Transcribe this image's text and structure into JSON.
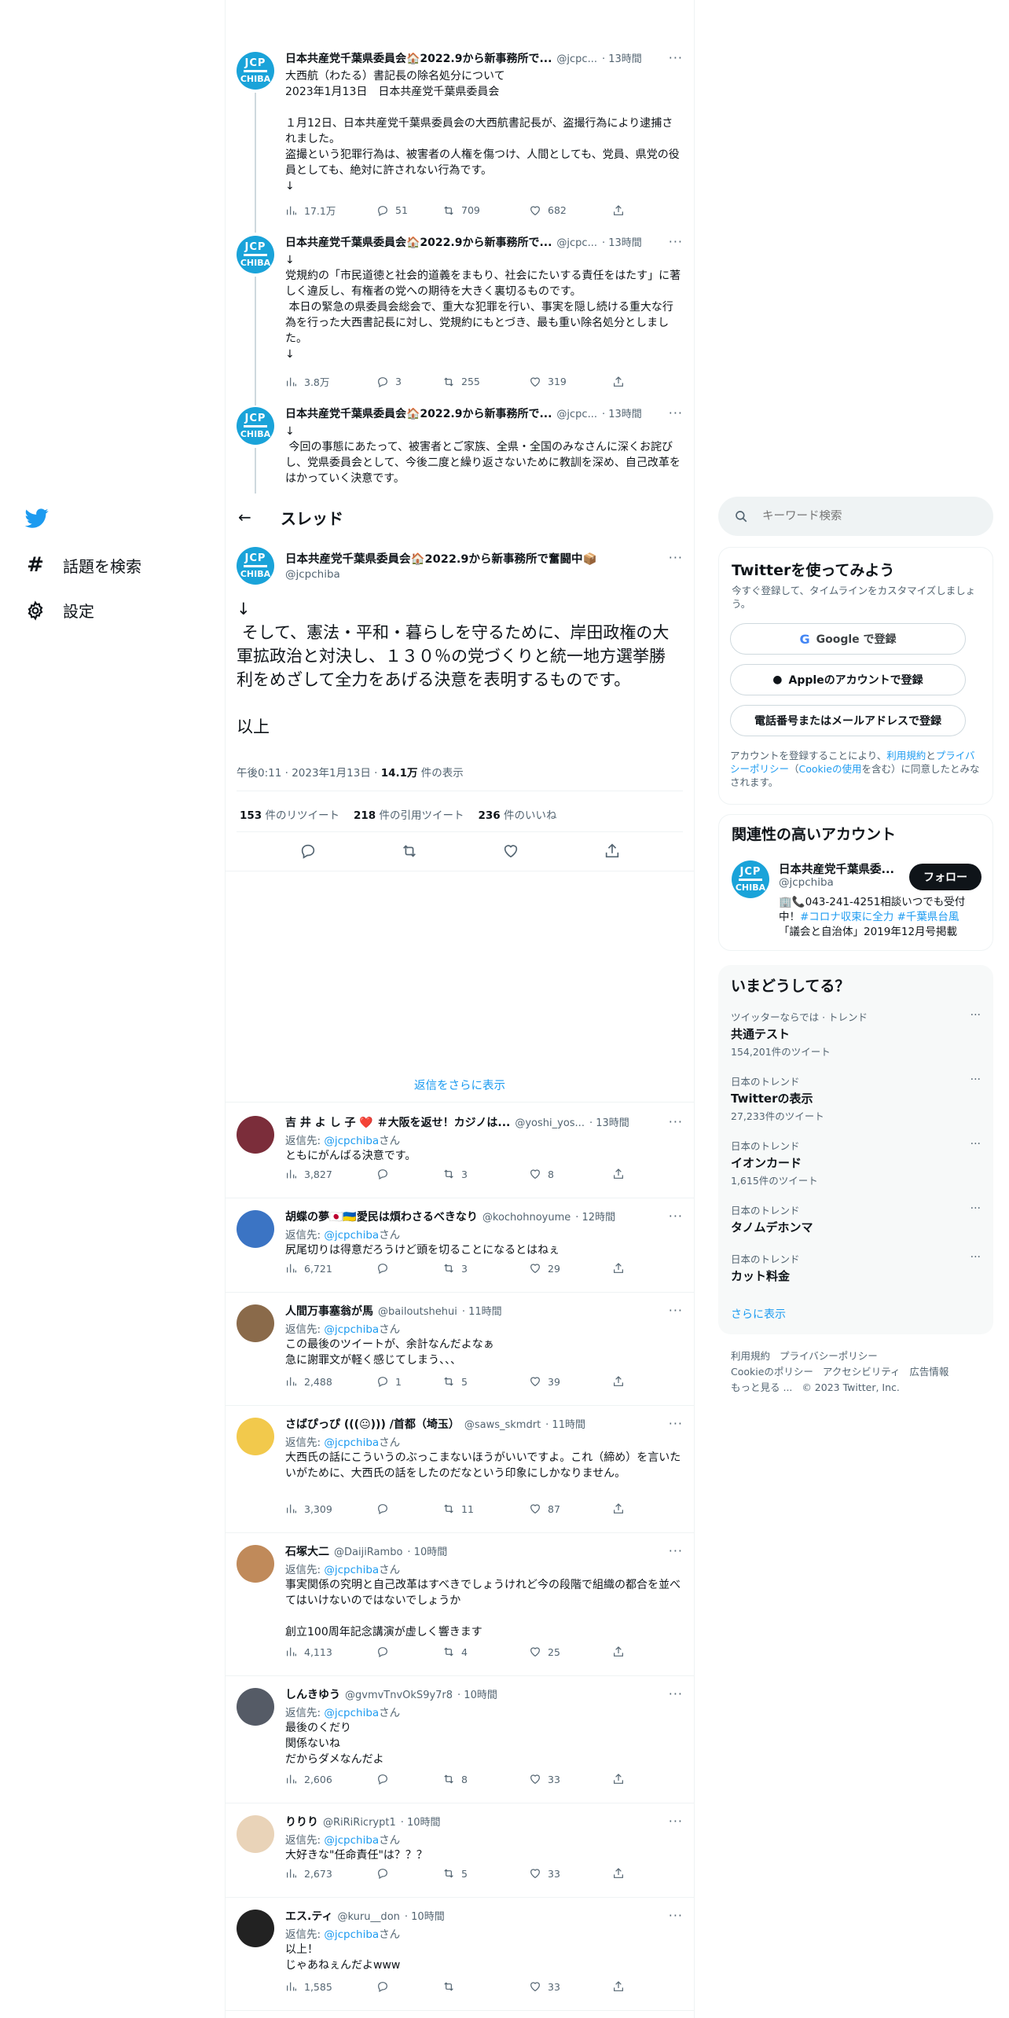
{
  "nav": {
    "explore_label": "話題を検索",
    "settings_label": "設定"
  },
  "thread_header": {
    "title": "スレッド"
  },
  "colors": {
    "accent": "#1d9bf0",
    "brand_avatar": "#1aa3d9"
  },
  "jcp_avatar": {
    "line1": "JCP",
    "line2": "CHIBA"
  },
  "context_tweets": [
    {
      "name": "日本共産党千葉県委員会🏠2022.9から新事務所で...",
      "handle": "@jcpc...",
      "time": "· 13時間",
      "text": "大西航（わたる）書記長の除名処分について\n2023年1月13日　日本共産党千葉県委員会\n\n１月12日、日本共産党千葉県委員会の大西航書記長が、盗撮行為により逮捕されました。\n盗撮という犯罪行為は、被害者の人権を傷つけ、人間としても、党員、県党の役員としても、絶対に許されない行為です。\n↓",
      "views": "17.1万",
      "replies": "51",
      "retweets": "709",
      "likes": "682"
    },
    {
      "name": "日本共産党千葉県委員会🏠2022.9から新事務所で...",
      "handle": "@jcpc...",
      "time": "· 13時間",
      "text": "↓\n党規約の「市民道徳と社会的道義をまもり、社会にたいする責任をはたす」に著しく違反し、有権者の党への期待を大きく裏切るものです。\n 本日の緊急の県委員会総会で、重大な犯罪を行い、事実を隠し続ける重大な行為を行った大西書記長に対し、党規約にもとづき、最も重い除名処分としました。\n↓",
      "views": "3.8万",
      "replies": "3",
      "retweets": "255",
      "likes": "319"
    },
    {
      "name": "日本共産党千葉県委員会🏠2022.9から新事務所で...",
      "handle": "@jcpc...",
      "time": "· 13時間",
      "text": "↓\n 今回の事態にあたって、被害者とご家族、全県・全国のみなさんに深くお詫びし、党県委員会として、今後二度と繰り返さないために教訓を深め、自己改革をはかっていく決意です。"
    }
  ],
  "main_tweet": {
    "name": "日本共産党千葉県委員会🏠2022.9から新事務所で奮闘中📦",
    "handle": "@jcpchiba",
    "text": "↓\n そして、憲法・平和・暮らしを守るために、岸田政権の大軍拡政治と対決し、１３０％の党づくりと統一地方選挙勝利をめざして全力をあげる決意を表明するものです。\n\n以上",
    "time": "午後0:11 · 2023年1月13日 · ",
    "views": "14.1万",
    "views_label": " 件の表示",
    "retweets": "153",
    "retweets_label": " 件のリツイート",
    "quotes": "218",
    "quotes_label": " 件の引用ツイート",
    "likes": "236",
    "likes_label": " 件のいいね"
  },
  "show_more_replies": "返信をさらに表示",
  "reply_prefix": "返信先: ",
  "reply_target": "@jcpchiba",
  "reply_suffix": "さん",
  "replies": [
    {
      "name": "吉 井 よ し 子 ❤️ ＃大阪を返せ！カジノは...",
      "handle": "@yoshi_yos...",
      "time": "· 13時間",
      "text": "ともにがんばる決意です。",
      "views": "3,827",
      "replies": "",
      "retweets": "3",
      "likes": "8"
    },
    {
      "name": "胡蝶の夢🇯🇵🇺🇦愛民は煩わさるべきなり",
      "handle": "@kochohnoyume",
      "time": "· 12時間",
      "text": "尻尾切りは得意だろうけど頭を切ることになるとはねぇ",
      "views": "6,721",
      "replies": "",
      "retweets": "3",
      "likes": "29"
    },
    {
      "name": "人間万事塞翁が馬",
      "handle": "@bailoutshehui",
      "time": "· 11時間",
      "text": "この最後のツイートが、余計なんだよなぁ\n急に謝罪文が軽く感じてしまう、、、",
      "views": "2,488",
      "replies": "1",
      "retweets": "5",
      "likes": "39"
    },
    {
      "name": "さばぴっぴ (((😐))) /首都（埼玉）",
      "handle": "@saws_skmdrt",
      "time": "· 11時間",
      "text": "大西氏の話にこういうのぶっこまないほうがいいですよ。これ（締め）を言いたいがために、大西氏の話をしたのだなという印象にしかなりません。",
      "views": "3,309",
      "replies": "",
      "retweets": "11",
      "likes": "87"
    },
    {
      "name": "石塚大二",
      "handle": "@DaijiRambo",
      "time": "· 10時間",
      "text": "事実関係の究明と自己改革はすべきでしょうけれど今の段階で組織の都合を並べてはいけないのではないでしょうか\n\n創立100周年記念講演が虚しく響きます",
      "views": "4,113",
      "replies": "",
      "retweets": "4",
      "likes": "25"
    },
    {
      "name": "しんきゆう",
      "handle": "@gvmvTnvOkS9y7r8",
      "time": "· 10時間",
      "text": "最後のくだり\n関係ないね\nだからダメなんだよ",
      "views": "2,606",
      "replies": "",
      "retweets": "8",
      "likes": "33"
    },
    {
      "name": "りりり",
      "handle": "@RiRiRicrypt1",
      "time": "· 10時間",
      "text": "大好きな\"任命責任\"は？？？",
      "views": "2,673",
      "replies": "",
      "retweets": "5",
      "likes": "33"
    },
    {
      "name": "エス.ティ",
      "handle": "@kuru__don",
      "time": "· 10時間",
      "text": "以上！\nじゃあねぇんだよwww",
      "views": "1,585",
      "replies": "",
      "retweets": "",
      "likes": "33"
    }
  ],
  "search": {
    "placeholder": "キーワード検索"
  },
  "signup": {
    "title": "Twitterを使ってみよう",
    "subtitle": "今すぐ登録して、タイムラインをカスタマイズしましょう。",
    "google_button": "Google で登録",
    "apple_button": "Appleのアカウントで登録",
    "phone_button": "電話番号またはメールアドレスで登録",
    "legal_prefix": "アカウントを登録することにより、",
    "legal_terms": "利用規約",
    "legal_and": "と",
    "legal_privacy": "プライバシーポリシー",
    "legal_open": "（",
    "legal_cookie": "Cookieの使用",
    "legal_suffix": "を含む）に同意したとみなされます。"
  },
  "relevant": {
    "title": "関連性の高いアカウント",
    "name": "日本共産党千葉県委...",
    "handle": "@jcpchiba",
    "follow_button": "フォロー",
    "bio_1": "🏢📞043-241-4251相談いつでも受付中！",
    "bio_tag1": "#コロナ収束に全力",
    "bio_tag2": "#千葉県台風",
    "bio_2": "「議会と自治体」2019年12月号掲載"
  },
  "trends": {
    "title": "いまどうしてる？",
    "items": [
      {
        "meta": "ツイッターならでは · トレンド",
        "title": "共通テスト",
        "count": "154,201件のツイート"
      },
      {
        "meta": "日本のトレンド",
        "title": "Twitterの表示",
        "count": "27,233件のツイート"
      },
      {
        "meta": "日本のトレンド",
        "title": "イオンカード",
        "count": "1,615件のツイート"
      },
      {
        "meta": "日本のトレンド",
        "title": "タノムデホンマ",
        "count": ""
      },
      {
        "meta": "日本のトレンド",
        "title": "カット料金",
        "count": ""
      }
    ],
    "show_more": "さらに表示"
  },
  "footer": {
    "terms": "利用規約",
    "privacy": "プライバシーポリシー",
    "cookie": "Cookieのポリシー",
    "accessibility": "アクセシビリティ",
    "ads": "広告情報",
    "more": "もっと見る ...",
    "copyright": "© 2023 Twitter, Inc."
  }
}
